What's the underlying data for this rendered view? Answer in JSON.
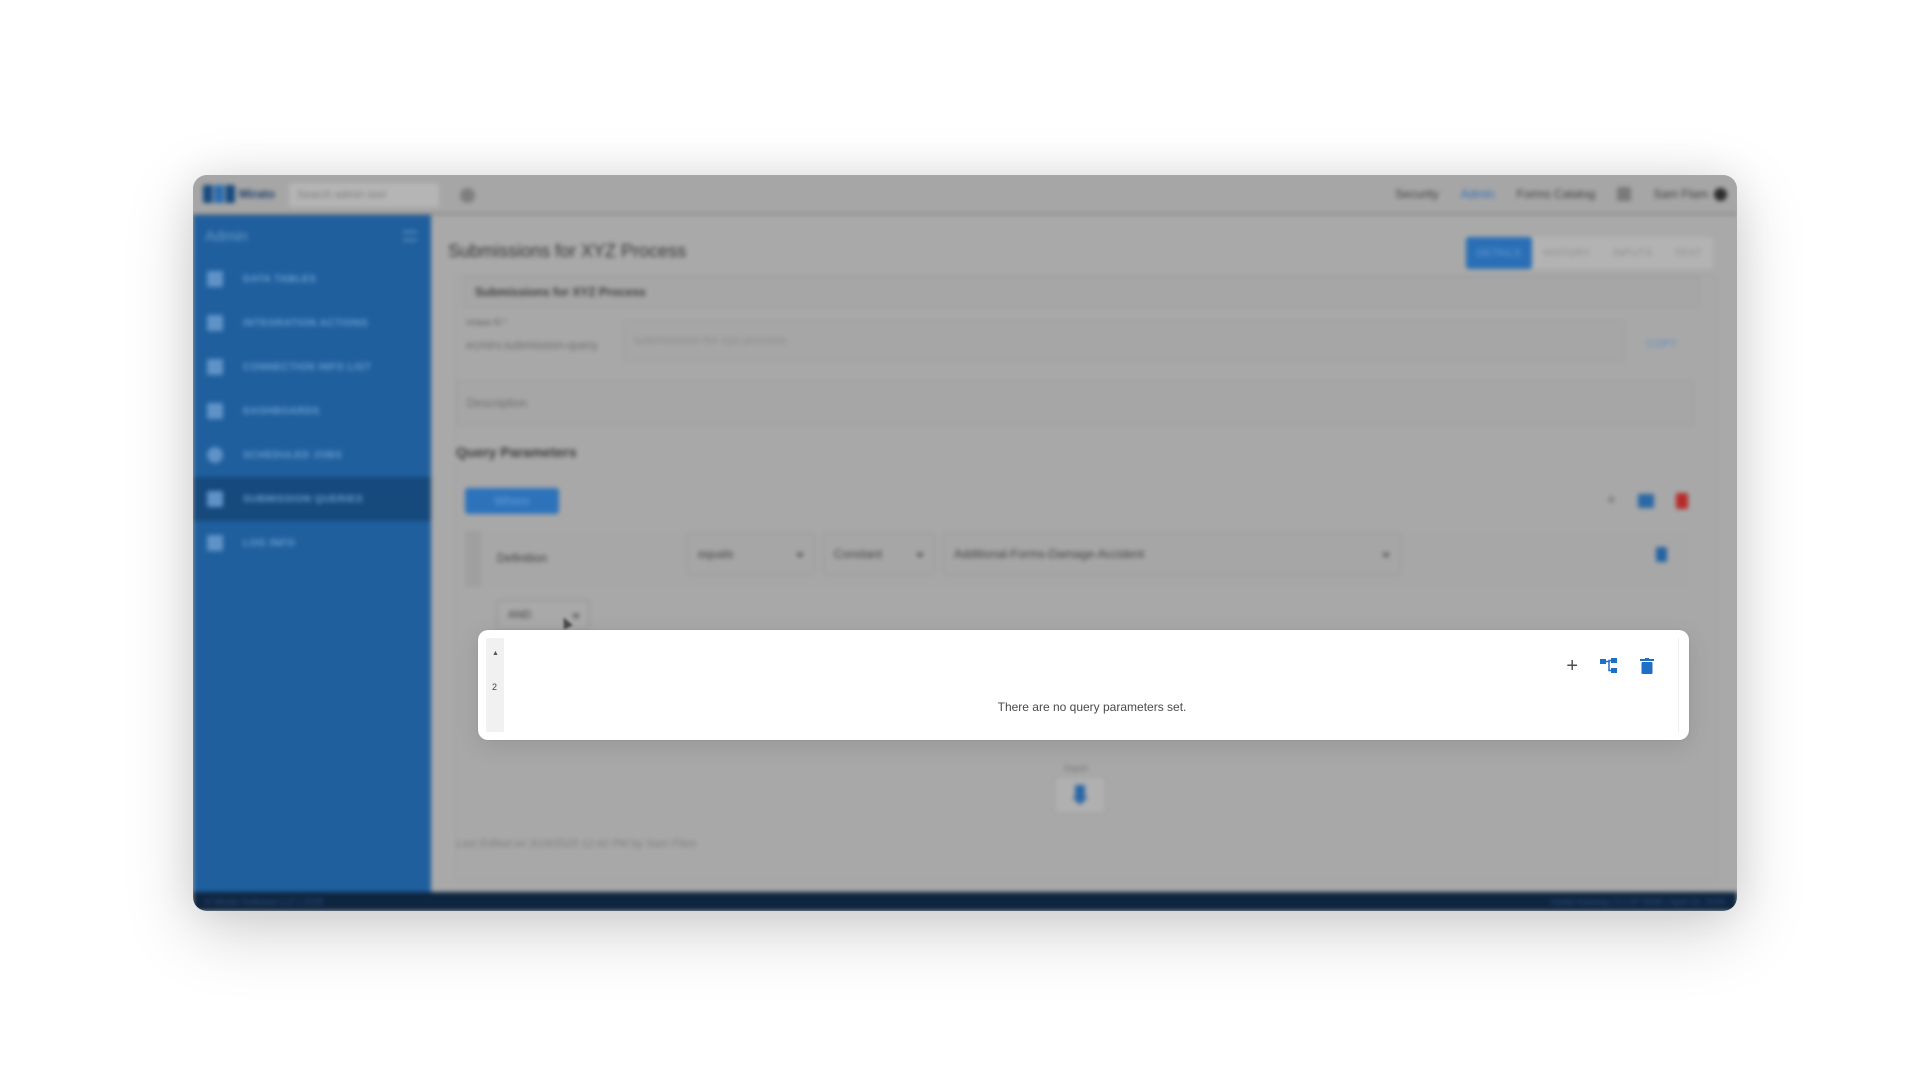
{
  "topbar": {
    "logo_text": "Mirato",
    "search_placeholder": "Search admin tool",
    "nav": [
      "Security",
      "Admin",
      "Forms Catalog"
    ],
    "user_name": "Sam Flam"
  },
  "sidebar": {
    "title": "Admin",
    "items": [
      {
        "label": "DATA TABLES",
        "icon": "table-icon"
      },
      {
        "label": "INTEGRATION ACTIONS",
        "icon": "integration-icon"
      },
      {
        "label": "CONNECTION INFO LIST",
        "icon": "connection-icon"
      },
      {
        "label": "DASHBOARDS",
        "icon": "dashboard-icon"
      },
      {
        "label": "SCHEDULED JOBS",
        "icon": "clock-icon"
      },
      {
        "label": "SUBMISSION QUERIES",
        "icon": "document-icon"
      },
      {
        "label": "LOG INFO",
        "icon": "link-icon"
      }
    ]
  },
  "page": {
    "title": "Submissions for XYZ Process",
    "tabs": [
      "DETAILS",
      "HISTORY",
      "INPUTS",
      "TEST"
    ],
    "name_value": "Submissions for XYZ Process",
    "uid_label": "Unique ID *",
    "uid_prefix": "ecmirv.submission-query",
    "uid_value": "submissions-for-xyz-process",
    "copy_label": "COPY",
    "description_placeholder": "Description",
    "query_params_title": "Query Parameters",
    "where_label": "Where",
    "definition_label": "Definition",
    "operator_value": "equals",
    "value_type": "Constant",
    "value": "Additional-Forms-Damage-Accident",
    "and_label": "AND",
    "empty_message": "There are no query parameters set.",
    "group_number": "2",
    "export_label": "Export",
    "last_edited": "Last Edited on 3/19/2025 12:42 PM by Sam Flam"
  },
  "footer": {
    "left": "© Mirato Software LLC | 2025",
    "right": "mirato-training | 3.1.87.5596 | April 22, 2025"
  },
  "colors": {
    "accent": "#2a6fb6",
    "sidebar": "#1f5f9e",
    "delete": "#b72a2a",
    "tree_icon": "#1f6fc7",
    "trash_icon": "#1f6fc7"
  }
}
